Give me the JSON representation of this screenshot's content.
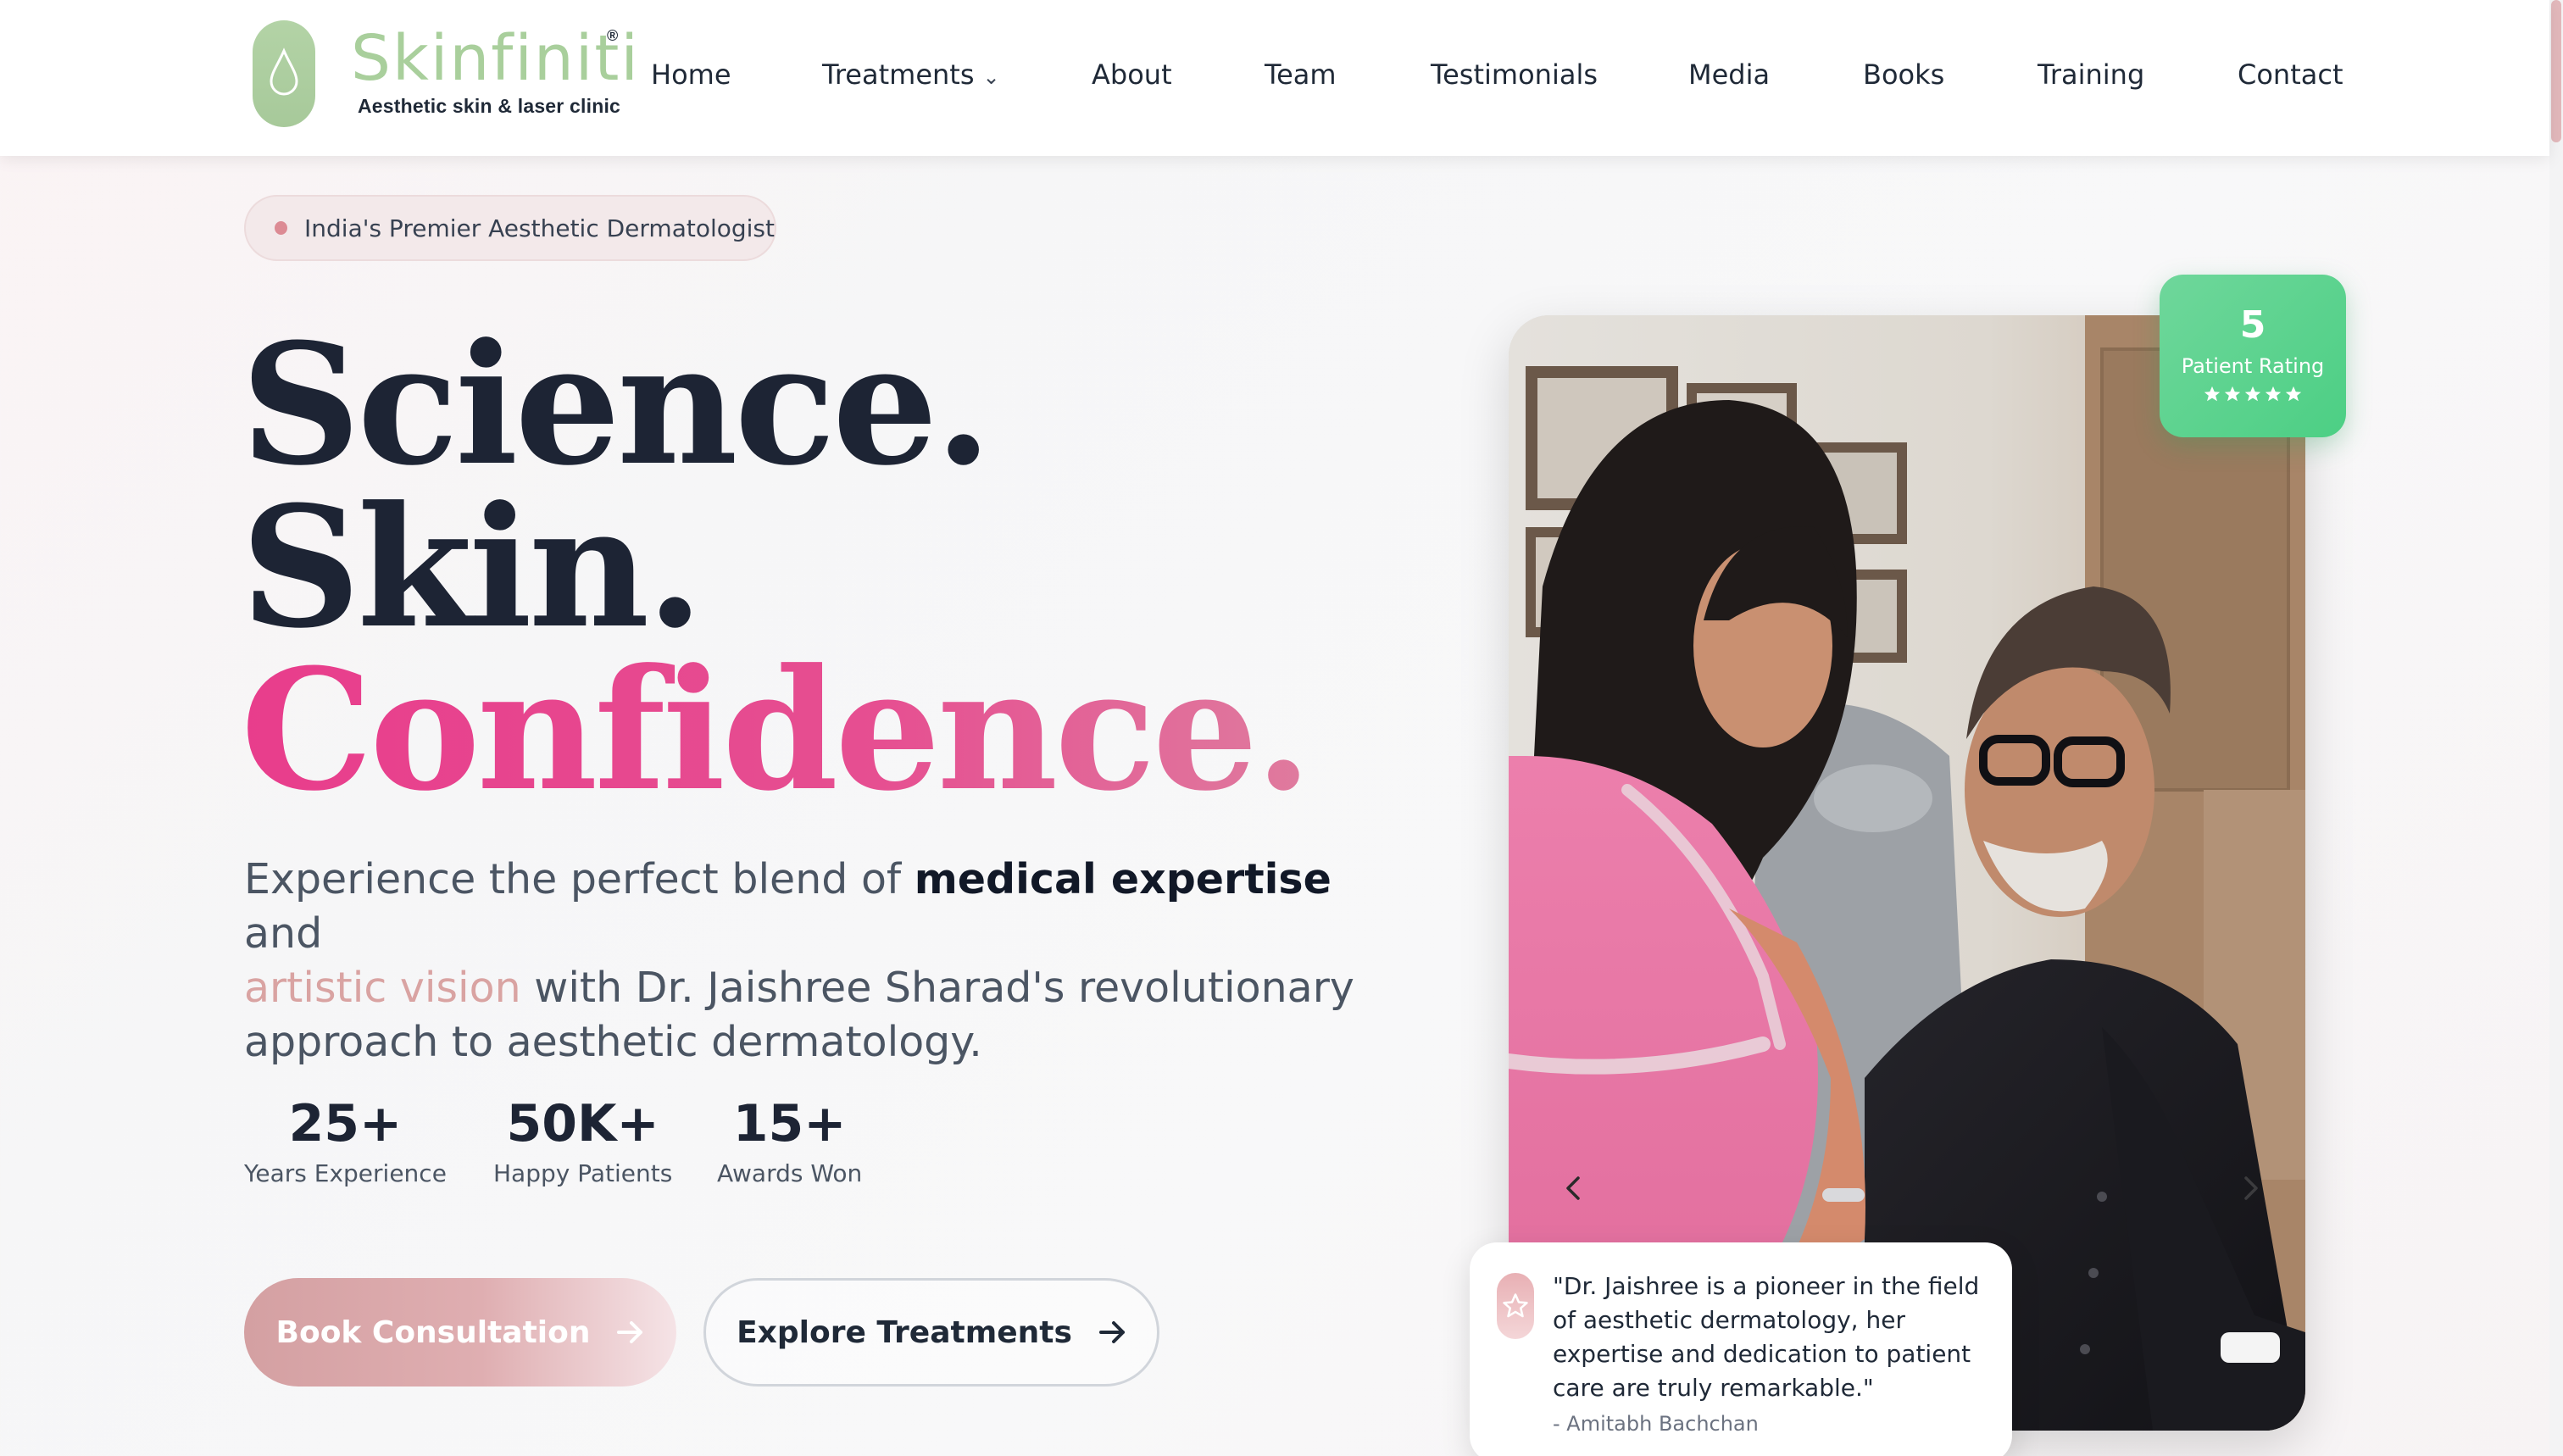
{
  "brand": {
    "name": "Skinfiniti",
    "registered": "®",
    "tagline": "Aesthetic skin & laser clinic",
    "color": "#a9cf9c"
  },
  "nav": {
    "items": [
      {
        "label": "Home"
      },
      {
        "label": "Treatments",
        "has_dropdown": true,
        "icon": "chevron-down-icon"
      },
      {
        "label": "About"
      },
      {
        "label": "Team"
      },
      {
        "label": "Testimonials"
      },
      {
        "label": "Media"
      },
      {
        "label": "Books"
      },
      {
        "label": "Training"
      },
      {
        "label": "Contact"
      }
    ]
  },
  "hero": {
    "badge": "India's Premier Aesthetic Dermatologist",
    "headline": [
      "Science.",
      "Skin.",
      "Confidence."
    ],
    "subtext": {
      "part1": "Experience the perfect blend of ",
      "strong": "medical expertise",
      "part2": " and ",
      "accent": "artistic vision",
      "part3": " with Dr. Jaishree Sharad's revolutionary approach to aesthetic dermatology."
    },
    "stats": [
      {
        "value": "25+",
        "label": "Years Experience"
      },
      {
        "value": "50K+",
        "label": "Happy Patients"
      },
      {
        "value": "15+",
        "label": "Awards Won"
      }
    ],
    "primary_button": "Book Consultation",
    "secondary_button": "Explore Treatments"
  },
  "rating": {
    "value": "5",
    "label": "Patient Rating",
    "stars": 5
  },
  "testimonial": {
    "quote": "\"Dr. Jaishree is a pioneer in the field of aesthetic dermatology, her expertise and dedication to patient care are truly remarkable.\"",
    "author": "- Amitabh Bachchan"
  },
  "colors": {
    "accent_pink": "#e83d8c",
    "rose": "#d9a3a2",
    "dark": "#1d2434",
    "rating_green": "#4ccf84"
  }
}
